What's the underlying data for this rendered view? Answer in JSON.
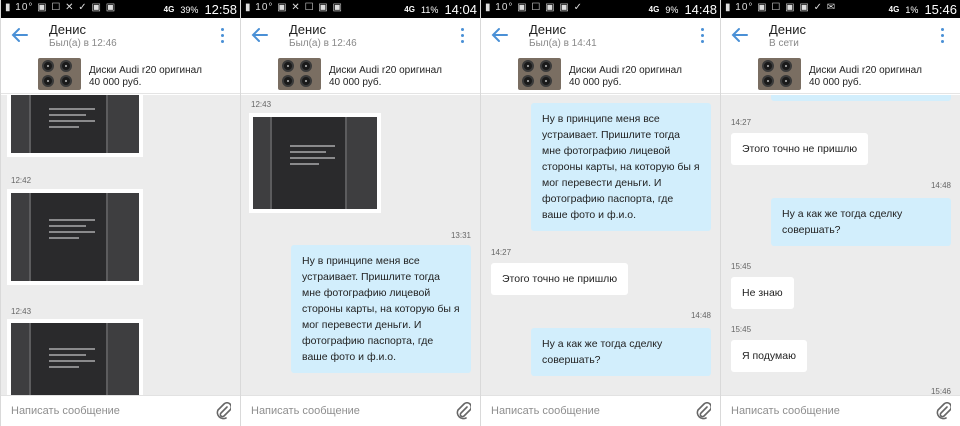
{
  "colors": {
    "accent": "#4a90d6",
    "outgoing_bubble": "#d2eefc",
    "incoming_bubble": "#ffffff",
    "chat_bg": "#ececec"
  },
  "common": {
    "contact_name": "Денис",
    "product_title": "Диски Audi r20 оригинал",
    "product_price": "40 000 руб.",
    "input_placeholder": "Написать сообщение"
  },
  "screens": [
    {
      "status": {
        "left": "▮ 10° ▣ ☐ ✕ ✓ ▣ ▣",
        "network": "4G",
        "battery": "39%",
        "time": "12:58"
      },
      "contact_status": "Был(а) в 12:46",
      "timestamps": [
        "12:42",
        "12:43"
      ],
      "photos": [
        "tire-photo",
        "tire-photo",
        "tire-photo"
      ]
    },
    {
      "status": {
        "left": "▮ 10° ▣ ✕ ☐ ▣ ▣",
        "network": "4G",
        "battery": "11%",
        "time": "14:04"
      },
      "contact_status": "Был(а) в 12:46",
      "timestamps": [
        "12:43",
        "13:31"
      ],
      "message": "Ну в принципе меня все устраивает. Пришлите тогда мне фотографию лицевой стороны карты, на которую бы я мог перевести деньги. И фотографию паспорта, где ваше фото и ф.и.о."
    },
    {
      "status": {
        "left": "▮ 10° ▣ ☐ ▣ ▣ ✓",
        "network": "4G",
        "battery": "9%",
        "time": "14:48"
      },
      "contact_status": "Был(а) в 14:41",
      "message_top": "Ну в принципе меня все устраивает. Пришлите тогда мне фотографию лицевой стороны карты, на которую бы я мог перевести деньги. И фотографию паспорта, где ваше фото и ф.и.о.",
      "ts_in": "14:27",
      "msg_in": "Этого точно не пришлю",
      "ts_out": "14:48",
      "msg_out": "Ну а как же тогда сделку совершать?"
    },
    {
      "status": {
        "left": "▮ 10° ▣ ☐ ▣ ▣ ✓ ✉",
        "network": "4G",
        "battery": "1%",
        "time": "15:46"
      },
      "contact_status": "В сети",
      "ts1": "14:27",
      "msg1": "Этого точно не пришлю",
      "ts2": "14:48",
      "msg2": "Ну а как же тогда сделку совершать?",
      "ts3": "15:45",
      "msg3": "Не знаю",
      "ts4": "15:45",
      "msg4": "Я подумаю",
      "ts5": "15:46"
    }
  ]
}
